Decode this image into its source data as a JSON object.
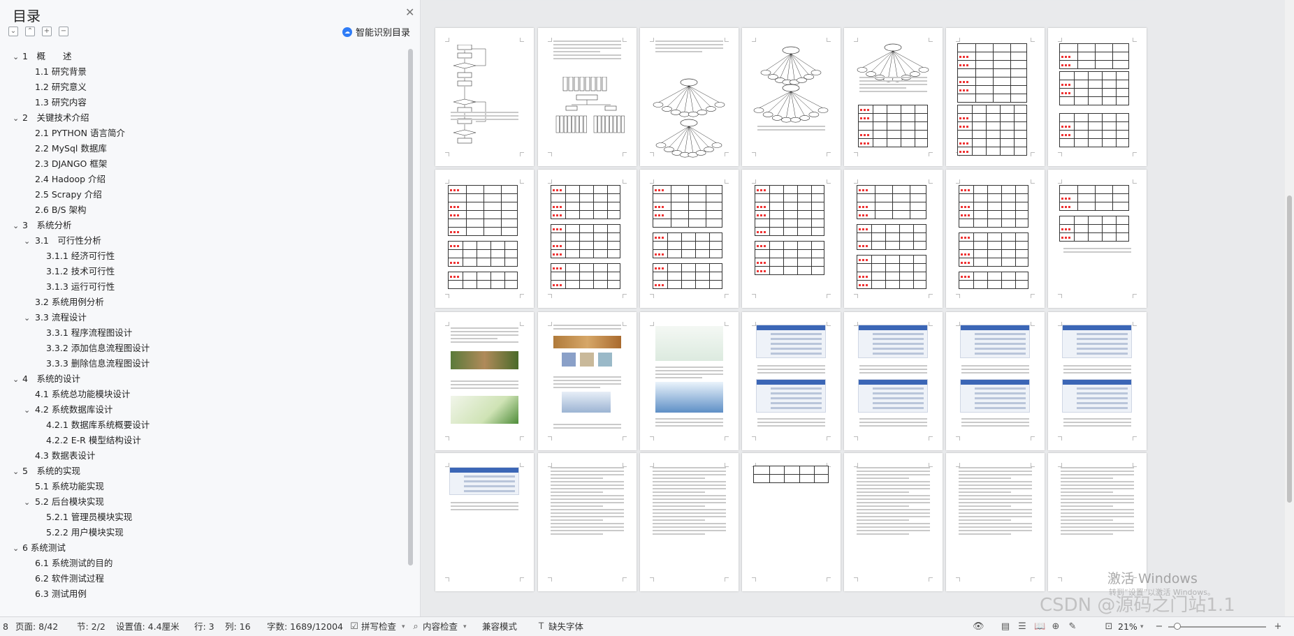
{
  "toc": {
    "title": "目录",
    "ai_button": "智能识别目录",
    "items": [
      {
        "text": "1　概　　述",
        "level": 0,
        "expanded": true
      },
      {
        "text": "1.1  研究背景",
        "level": 1
      },
      {
        "text": "1.2  研究意义",
        "level": 1
      },
      {
        "text": "1.3  研究内容",
        "level": 1
      },
      {
        "text": "2　关键技术介绍",
        "level": 0,
        "expanded": true
      },
      {
        "text": "2.1 PYTHON 语言简介",
        "level": 1
      },
      {
        "text": "2.2 MySql 数据库",
        "level": 1
      },
      {
        "text": "2.3 DJANGO 框架",
        "level": 1
      },
      {
        "text": "2.4 Hadoop 介绍",
        "level": 1
      },
      {
        "text": "2.5 Scrapy 介绍",
        "level": 1
      },
      {
        "text": "2.6 B/S 架构",
        "level": 1
      },
      {
        "text": "3　系统分析",
        "level": 0,
        "expanded": true
      },
      {
        "text": "3.1　可行性分析",
        "level": 1,
        "expanded": true
      },
      {
        "text": "3.1.1 经济可行性",
        "level": 2
      },
      {
        "text": "3.1.2 技术可行性",
        "level": 2
      },
      {
        "text": "3.1.3 运行可行性",
        "level": 2
      },
      {
        "text": "3.2 系统用例分析",
        "level": 1
      },
      {
        "text": "3.3 流程设计",
        "level": 1,
        "expanded": true
      },
      {
        "text": "3.3.1 程序流程图设计",
        "level": 2
      },
      {
        "text": "3.3.2 添加信息流程图设计",
        "level": 2
      },
      {
        "text": "3.3.3 删除信息流程图设计",
        "level": 2
      },
      {
        "text": "4　系统的设计",
        "level": 0,
        "expanded": true
      },
      {
        "text": "4.1  系统总功能模块设计",
        "level": 1
      },
      {
        "text": "4.2  系统数据库设计",
        "level": 1,
        "expanded": true
      },
      {
        "text": "4.2.1  数据库系统概要设计",
        "level": 2
      },
      {
        "text": "4.2.2 E-R 模型结构设计",
        "level": 2
      },
      {
        "text": "4.3 数据表设计",
        "level": 1
      },
      {
        "text": "5　系统的实现",
        "level": 0,
        "expanded": true
      },
      {
        "text": "5.1 系统功能实现",
        "level": 1
      },
      {
        "text": "5.2 后台模块实现",
        "level": 1,
        "expanded": true
      },
      {
        "text": "5.2.1 管理员模块实现",
        "level": 2
      },
      {
        "text": "5.2.2 用户模块实现",
        "level": 2
      },
      {
        "text": "6 系统测试",
        "level": 0,
        "expanded": true
      },
      {
        "text": "6.1 系统测试的目的",
        "level": 1
      },
      {
        "text": "6.2 软件测试过程",
        "level": 1
      },
      {
        "text": "6.3 测试用例",
        "level": 1
      }
    ]
  },
  "watermark": {
    "activate": "激活 Windows",
    "activate_sub": "转到“设置”以激活 Windows。",
    "csdn": "CSDN @源码之门站1.1"
  },
  "status": {
    "page_num": "8",
    "page": "页面: 8/42",
    "section": "节: 2/2",
    "setting": "设置值: 4.4厘米",
    "row": "行: 3",
    "col": "列: 16",
    "words": "字数: 1689/12004",
    "spell": "拼写检查",
    "content_check": "内容检查",
    "compat": "兼容模式",
    "missing_font": "缺失字体",
    "zoom": "21%"
  },
  "colors": {
    "accent": "#2f7cf6",
    "spell_wave": "#e33333",
    "header_blue": "#3b66b6"
  }
}
